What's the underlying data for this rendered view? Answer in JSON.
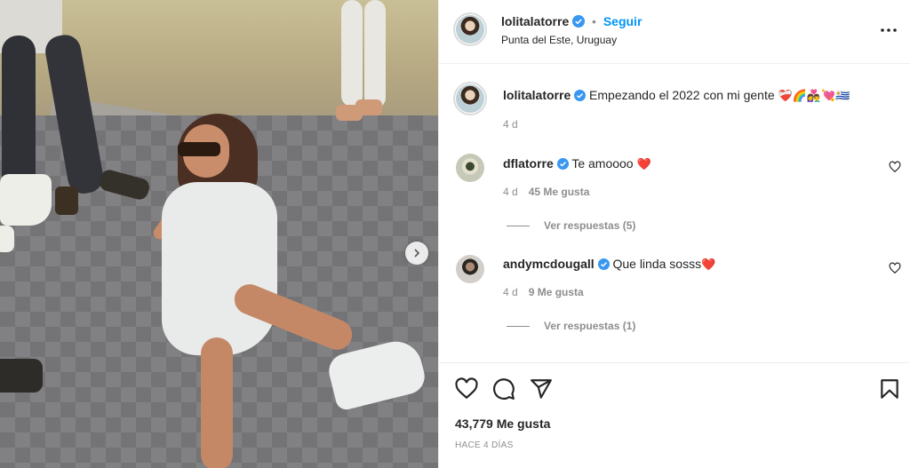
{
  "post": {
    "image_alt": "",
    "next_icon": "chevron-right-icon"
  },
  "header": {
    "username": "lolitalatorre",
    "separator": "•",
    "follow_label": "Seguir",
    "location": "Punta del Este, Uruguay",
    "more_icon": "more-horizontal-icon"
  },
  "caption": {
    "username": "lolitalatorre",
    "text": "Empezando el 2022 con mi gente",
    "emojis": "❤️‍🩹🌈👩‍❤️‍👨💘🇺🇾",
    "time": "4 d"
  },
  "comments": [
    {
      "username": "dflatorre",
      "text": "Te amoooo",
      "emoji": "❤️",
      "time": "4 d",
      "likes": "45 Me gusta",
      "replies": "Ver respuestas (5)"
    },
    {
      "username": "andymcdougall",
      "text": "Que linda sosss",
      "emoji": "❤️",
      "time": "4 d",
      "likes": "9 Me gusta",
      "replies": "Ver respuestas (1)"
    }
  ],
  "actions": {
    "like_icon": "heart-icon",
    "comment_icon": "comment-icon",
    "share_icon": "share-icon",
    "save_icon": "bookmark-icon"
  },
  "likes_total": "43,779 Me gusta",
  "posted": "HACE 4 DÍAS",
  "colors": {
    "accent": "#0095f6",
    "verified": "#3897f0",
    "heart_red": "#ed4956",
    "text": "#262626",
    "muted": "#8e8e8e"
  }
}
